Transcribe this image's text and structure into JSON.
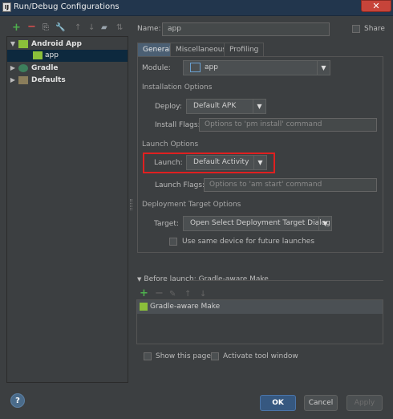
{
  "window": {
    "title": "Run/Debug Configurations",
    "app_badge": "IJ",
    "close_glyph": "✕"
  },
  "toolbar": {
    "icons": [
      {
        "glyph": "+",
        "color": "#4eb14e"
      },
      {
        "glyph": "−",
        "color": "#d94f4f"
      },
      {
        "glyph": "⎘",
        "color": "#aaaaaa"
      },
      {
        "glyph": "🔧",
        "color": "#c89a3e"
      },
      {
        "glyph": "↑",
        "color": "#777777"
      },
      {
        "glyph": "↓",
        "color": "#777777"
      },
      {
        "glyph": "▰",
        "color": "#9aa4ad"
      },
      {
        "glyph": "⇅",
        "color": "#777777"
      }
    ]
  },
  "tree": {
    "android_app": "Android App",
    "app": "app",
    "gradle": "Gradle",
    "defaults": "Defaults"
  },
  "name": {
    "label": "Name:",
    "value": "app"
  },
  "share": {
    "label": "Share"
  },
  "tabs": [
    "General",
    "Miscellaneous",
    "Profiling"
  ],
  "module": {
    "label": "Module:",
    "value": "app"
  },
  "installation": {
    "section": "Installation Options",
    "deploy_label": "Deploy:",
    "deploy_value": "Default APK",
    "flags_label": "Install Flags:",
    "flags_placeholder": "Options to 'pm install' command"
  },
  "launch": {
    "section": "Launch Options",
    "launch_label": "Launch:",
    "launch_value": "Default Activity",
    "flags_label": "Launch Flags:",
    "flags_placeholder": "Options to 'am start' command"
  },
  "deployment": {
    "section": "Deployment Target Options",
    "target_label": "Target:",
    "target_value": "Open Select Deployment Target Dialog",
    "same_device_label": "Use same device for future launches"
  },
  "before_launch": {
    "header": "Before launch: Gradle-aware Make",
    "item": "Gradle-aware Make"
  },
  "footer": {
    "show_page": "Show this page",
    "activate_window": "Activate tool window",
    "ok": "OK",
    "cancel": "Cancel",
    "apply": "Apply",
    "help": "?"
  },
  "colors": {
    "highlight": "#e02020",
    "accent": "#365880",
    "background": "#3c3f41"
  }
}
